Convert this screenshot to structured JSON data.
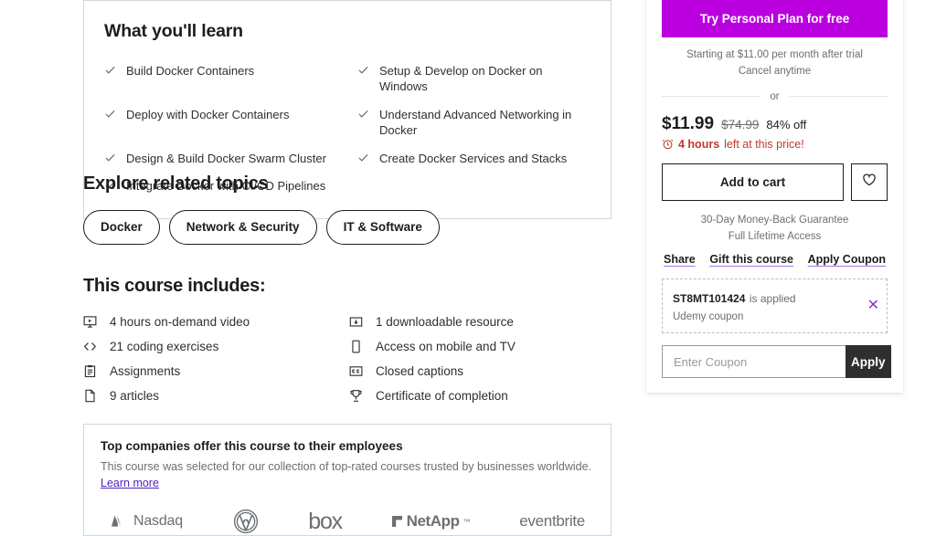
{
  "learn": {
    "title": "What you'll learn",
    "items": [
      "Build Docker Containers",
      "Setup & Develop on Docker on Windows",
      "Deploy with Docker Containers",
      "Understand Advanced Networking in Docker",
      "Design & Build Docker Swarm Cluster",
      "Create Docker Services and Stacks",
      "Integrate Docker with CI/CD Pipelines"
    ]
  },
  "topics": {
    "title": "Explore related topics",
    "pills": [
      "Docker",
      "Network & Security",
      "IT & Software"
    ]
  },
  "includes": {
    "title": "This course includes:",
    "left": [
      {
        "icon": "video-monitor-icon",
        "label": "4 hours on-demand video"
      },
      {
        "icon": "code-brackets-icon",
        "label": "21 coding exercises"
      },
      {
        "icon": "clipboard-icon",
        "label": "Assignments"
      },
      {
        "icon": "article-page-icon",
        "label": "9 articles"
      }
    ],
    "right": [
      {
        "icon": "download-resource-icon",
        "label": "1 downloadable resource"
      },
      {
        "icon": "mobile-device-icon",
        "label": "Access on mobile and TV"
      },
      {
        "icon": "closed-captions-icon",
        "label": "Closed captions"
      },
      {
        "icon": "trophy-icon",
        "label": "Certificate of completion"
      }
    ]
  },
  "companies": {
    "title": "Top companies offer this course to their employees",
    "description": "This course was selected for our collection of top-rated courses trusted by businesses worldwide.",
    "link_label": "Learn more",
    "logos": [
      "Nasdaq",
      "Volkswagen",
      "box",
      "NetApp",
      "eventbrite"
    ]
  },
  "sidebar": {
    "personal_plan_button": "Try Personal Plan for free",
    "trial_note_line1": "Starting at $11.00 per month after trial",
    "trial_note_line2": "Cancel anytime",
    "divider_label": "or",
    "price_current": "$11.99",
    "price_original": "$74.99",
    "discount": "84% off",
    "urgency_bold": "4 hours",
    "urgency_rest": "left at this price!",
    "add_to_cart": "Add to cart",
    "guarantee_line1": "30-Day Money-Back Guarantee",
    "guarantee_line2": "Full Lifetime Access",
    "links": [
      "Share",
      "Gift this course",
      "Apply Coupon"
    ],
    "coupon": {
      "code": "ST8MT101424",
      "applied_text": "is applied",
      "source": "Udemy coupon",
      "remove_icon": "✕",
      "input_placeholder": "Enter Coupon",
      "input_value": "",
      "apply_button": "Apply"
    }
  },
  "colors": {
    "brand_purple": "#bb00e0",
    "link_purple": "#5022c3",
    "urgency_red": "#c0392b",
    "apply_dark": "#2d2f31"
  }
}
